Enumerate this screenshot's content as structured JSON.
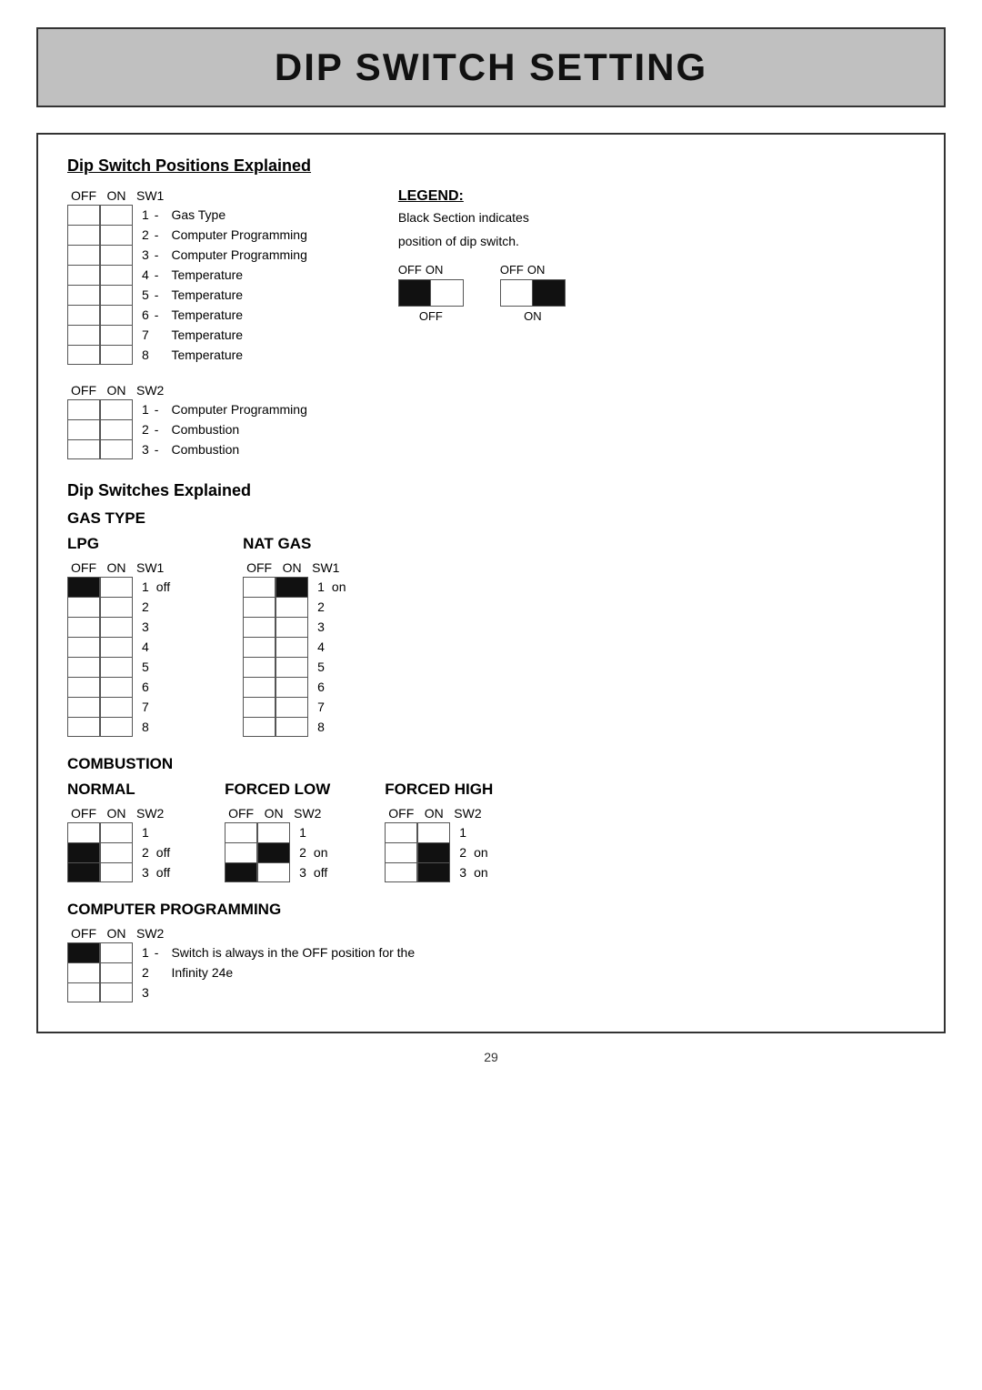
{
  "page": {
    "title": "DIP SWITCH SETTING",
    "page_number": "29"
  },
  "sections": {
    "positions_explained": {
      "title": "Dip Switch Positions Explained",
      "sw1_label": "OFF  ON  SW1",
      "sw2_label": "OFF  ON  SW2",
      "sw1_rows": [
        {
          "number": "1",
          "dash": "-",
          "desc": "Gas Type"
        },
        {
          "number": "2",
          "dash": "-",
          "desc": "Computer Programming"
        },
        {
          "number": "3",
          "dash": "-",
          "desc": "Computer Programming"
        },
        {
          "number": "4",
          "dash": "-",
          "desc": "Temperature"
        },
        {
          "number": "5",
          "dash": "-",
          "desc": "Temperature"
        },
        {
          "number": "6",
          "dash": "-",
          "desc": "Temperature"
        },
        {
          "number": "7",
          "dash": "",
          "desc": "Temperature"
        },
        {
          "number": "8",
          "dash": "",
          "desc": "Temperature"
        }
      ],
      "sw2_rows": [
        {
          "number": "1",
          "dash": "-",
          "desc": "Computer Programming"
        },
        {
          "number": "2",
          "dash": "-",
          "desc": "Combustion"
        },
        {
          "number": "3",
          "dash": "-",
          "desc": "Combustion"
        }
      ],
      "legend": {
        "title": "LEGEND:",
        "text1": "Black Section indicates",
        "text2": "position of dip switch.",
        "off_label": "OFF ON",
        "on_label": "OFF ON",
        "off_text": "OFF",
        "on_text": "ON"
      }
    },
    "dip_switches_explained": {
      "title": "Dip Switches Explained",
      "gas_type": {
        "title": "GAS TYPE",
        "lpg_title": "LPG",
        "nat_gas_title": "NAT GAS",
        "lpg_label": "OFF  ON  SW1",
        "nat_label": "OFF  ON  SW1",
        "lpg_note_1": "off",
        "nat_note_1": "on"
      },
      "combustion": {
        "title": "COMBUSTION",
        "normal_title": "NORMAL",
        "forced_low_title": "FORCED LOW",
        "forced_high_title": "FORCED HIGH",
        "normal_label": "OFF  ON  SW2",
        "forced_low_label": "OFF  ON  SW2",
        "forced_high_label": "OFF  ON  SW2",
        "normal_note_2": "off",
        "normal_note_3": "off",
        "forced_low_note_2": "on",
        "forced_low_note_3": "off",
        "forced_high_note_2": "on",
        "forced_high_note_3": "on"
      },
      "computer_prog": {
        "title": "COMPUTER PROGRAMMING",
        "label": "OFF  ON  SW2",
        "rows": [
          {
            "number": "1",
            "dash": "-",
            "desc": "Switch is always in the OFF position for the"
          },
          {
            "number": "2",
            "dash": "",
            "desc": "Infinity 24e"
          },
          {
            "number": "3",
            "dash": "",
            "desc": ""
          }
        ]
      }
    }
  }
}
